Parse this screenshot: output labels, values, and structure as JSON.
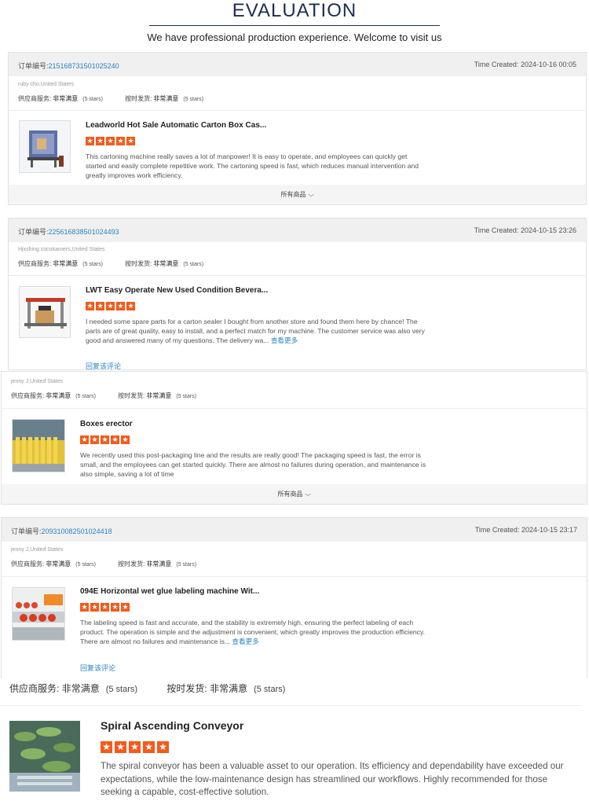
{
  "header": {
    "title": "EVALUATION",
    "subtitle": "We have professional production experience. Welcome to visit us"
  },
  "labels": {
    "order_no": "订单编号:",
    "time_created": "Time Created:",
    "supplier_service": "供应商服务:",
    "on_time_shipping": "按时发货:",
    "very_satisfied": "非常满意",
    "stars_5": "(5 stars)",
    "all_products": "所有商品",
    "reply": "回复该评论",
    "view_more": "查看更多"
  },
  "orders": [
    {
      "order_number": "215168731501025240",
      "time": "2024-10-16 00:05",
      "reviewer": "ruby cho,United States",
      "product_title": "Leadworld Hot Sale Automatic Carton Box Cas...",
      "rating": 5,
      "review": "This cartoning machine really saves a lot of manpower! It is easy to operate, and employees can quickly get started and easily complete repetitive work. The cartoning speed is fast, which reduces manual intervention and greatly improves work efficiency."
    },
    {
      "order_number": "225616838501024493",
      "time": "2024-10-15 23:26",
      "reviewer": "Hjxshing cocokamers,United States",
      "product_title": "LWT Easy Operate New Used Condition Bevera...",
      "rating": 5,
      "review": "I needed some spare parts for a carton sealer I bought from another store and found them here by chance! The parts are of great quality, easy to install, and a perfect match for my machine. The customer service was also very good and answered many of my questions. The delivery wa..."
    },
    {
      "order_number": "",
      "time": "",
      "reviewer": "jenny J,United States",
      "product_title": "Boxes erector",
      "rating": 5,
      "review": "We recently used this post-packaging line and the results are really good! The packaging speed is fast, the error is small, and the employees can get started quickly. There are almost no failures during operation, and maintenance is also simple, saving a lot of time"
    },
    {
      "order_number": "209310082501024418",
      "time": "2024-10-15 23:17",
      "reviewer": "jenny J,United States",
      "product_title": "094E Horizontal wet glue labeling machine Wit...",
      "rating": 5,
      "review": "The labeling speed is fast and accurate, and the stability is extremely high, ensuring the perfect labeling of each product. The operation is simple and the adjustment is convenient, which greatly improves the production efficiency. There are almost no failures and maintenance is..."
    },
    {
      "product_title": "Spiral Ascending Conveyor",
      "rating": 5,
      "review": "The spiral conveyor has been a valuable asset to our operation. Its efficiency and dependability have exceeded our expectations, while the low-maintenance design has streamlined our workflows. Highly recommended for those seeking a capable, cost-effective solution."
    }
  ],
  "colors": {
    "star": "#f35b1c",
    "link": "#2a82c8",
    "title": "#1e2d4f"
  },
  "icons": {
    "star": "star-icon",
    "chevron": "chevron-down-icon"
  }
}
